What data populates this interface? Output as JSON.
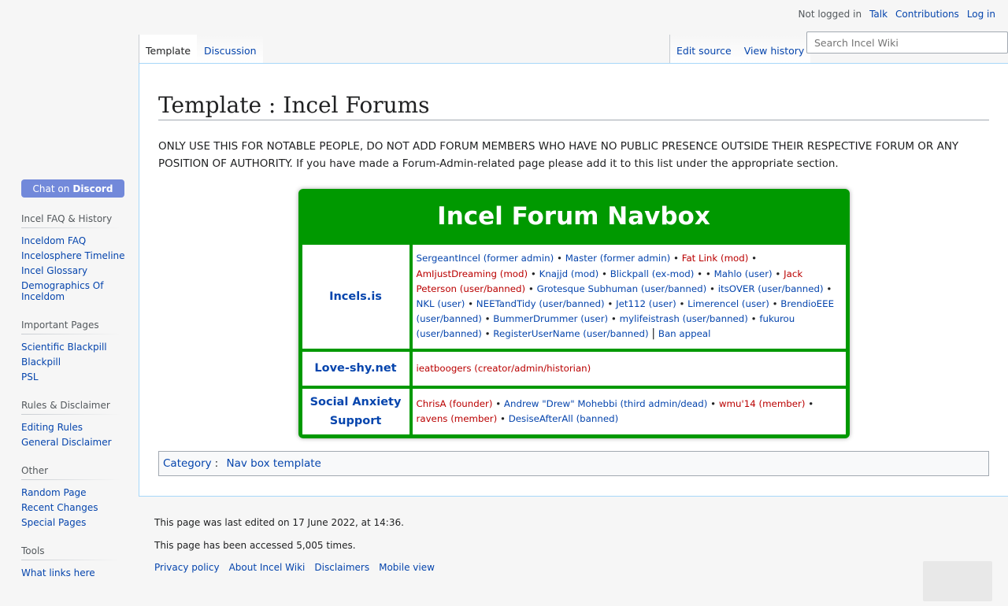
{
  "personal": {
    "not_logged_in": "Not logged in",
    "talk": "Talk",
    "contributions": "Contributions",
    "login": "Log in"
  },
  "tabs": {
    "template": "Template",
    "discussion": "Discussion",
    "edit_source": "Edit source",
    "view_history": "View history"
  },
  "search": {
    "placeholder": "Search Incel Wiki"
  },
  "sidebar": {
    "chat": {
      "prefix": "Chat on",
      "brand": "Discord",
      "color": "#7289da"
    },
    "sections": [
      {
        "title": "Incel FAQ & History",
        "items": [
          "Inceldom FAQ",
          "Incelosphere Timeline",
          "Incel Glossary",
          "Demographics Of Inceldom"
        ]
      },
      {
        "title": "Important Pages",
        "items": [
          "Scientific Blackpill",
          "Blackpill",
          "PSL"
        ]
      },
      {
        "title": "Rules & Disclaimer",
        "items": [
          "Editing Rules",
          "General Disclaimer"
        ]
      },
      {
        "title": "Other",
        "items": [
          "Random Page",
          "Recent Changes",
          "Special Pages"
        ]
      },
      {
        "title": "Tools",
        "items": [
          "What links here"
        ]
      }
    ]
  },
  "page": {
    "title": "Template : Incel Forums",
    "notice": "ONLY USE THIS FOR NOTABLE PEOPLE, DO NOT ADD FORUM MEMBERS WHO HAVE NO PUBLIC PRESENCE OUTSIDE THEIR RESPECTIVE FORUM OR ANY POSITION OF AUTHORITY. If you have made a Forum-Admin-related page please add it to this list under the appropriate section."
  },
  "navbox": {
    "title": "Incel Forum Navbox",
    "accent": "#009900",
    "rows": {
      "incels": {
        "group": "Incels.is",
        "a1": "SergeantIncel (former admin)",
        "a2": "Master (former admin)",
        "a3": "Fat Link (mod)",
        "a4": "AmIjustDreaming (mod)",
        "a5": "Knajjd (mod)",
        "a6": "Blickpall (ex-mod)",
        "a7": "Mahlo (user)",
        "a8": "Jack Peterson (user/banned)",
        "a9": "Grotesque Subhuman (user/banned)",
        "a10": "itsOVER (user/banned)",
        "a11": "NKL (user)",
        "a12": "NEETandTidy (user/banned)",
        "a13": "Jet112 (user)",
        "a14": "Limerencel (user)",
        "a15": "BrendioEEE (user/banned)",
        "a16": "BummerDrummer (user)",
        "a17": "mylifeistrash (user/banned)",
        "a18": "fukurou (user/banned)",
        "a19": "RegisterUserName (user/banned)",
        "a20": "Ban appeal"
      },
      "loveshy": {
        "group": "Love-shy.net",
        "a1": "ieatboogers (creator/admin/historian)"
      },
      "sas": {
        "group": "Social Anxiety Support",
        "a1": "ChrisA (founder)",
        "a2": "Andrew \"Drew\" Mohebbi (third admin/dead)",
        "a3": "wmu'14 (member)",
        "a4": "ravens (member)",
        "a5": "DesiseAfterAll (banned)"
      }
    }
  },
  "catlinks": {
    "label": "Category",
    "colon": ":",
    "item": "Nav box template"
  },
  "footer": {
    "last_edited": "This page was last edited on 17 June 2022, at 14:36.",
    "accessed": "This page has been accessed 5,005 times.",
    "places": [
      "Privacy policy",
      "About Incel Wiki",
      "Disclaimers",
      "Mobile view"
    ]
  }
}
